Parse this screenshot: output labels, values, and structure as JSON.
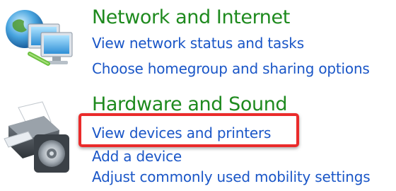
{
  "colors": {
    "title": "#1e8a1e",
    "link": "#1a56c7",
    "highlight": "#ea2b2b"
  },
  "categories": [
    {
      "title": "Network and Internet",
      "icon": "network-globe-icon",
      "links": [
        "View network status and tasks",
        "Choose homegroup and sharing options"
      ]
    },
    {
      "title": "Hardware and Sound",
      "icon": "printer-speaker-icon",
      "links": [
        "View devices and printers",
        "Add a device",
        "Adjust commonly used mobility settings"
      ]
    }
  ]
}
